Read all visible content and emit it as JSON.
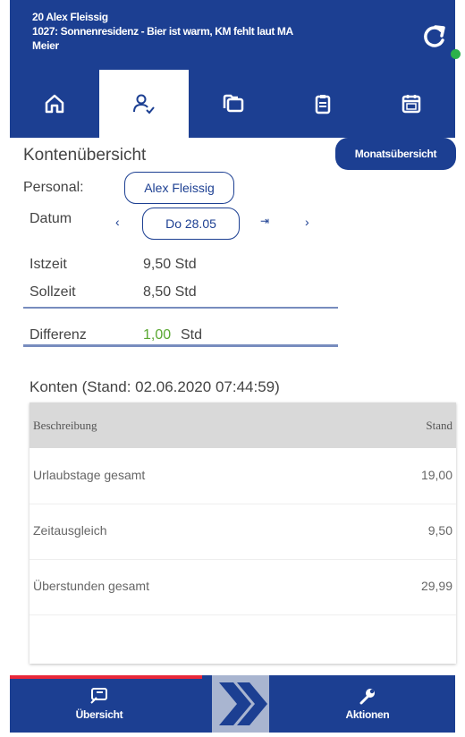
{
  "header": {
    "line1": "20 Alex Fleissig",
    "line2": "1027: Sonnenresidenz - Bier ist warm, KM fehlt laut MA",
    "line3": "Meier",
    "sync_icon": "refresh-icon",
    "status_color": "#2db24a"
  },
  "tabs": [
    {
      "icon": "home-icon",
      "active": false
    },
    {
      "icon": "user-check-icon",
      "active": true
    },
    {
      "icon": "folders-icon",
      "active": false
    },
    {
      "icon": "clipboard-icon",
      "active": false
    },
    {
      "icon": "calendar-icon",
      "active": false
    }
  ],
  "main": {
    "title": "Kontenübersicht",
    "month_button": "Monatsübersicht",
    "personal_label": "Personal:",
    "personal_value": "Alex Fleissig",
    "date_label": "Datum",
    "date_prev": "‹",
    "date_value": "Do 28.05",
    "date_today": "⇥",
    "date_next": "›",
    "istzeit_label": "Istzeit",
    "istzeit_value": "9,50 Std",
    "sollzeit_label": "Sollzeit",
    "sollzeit_value": "8,50 Std",
    "differenz_label": "Differenz",
    "differenz_num": "1,00",
    "differenz_unit": "Std"
  },
  "konten": {
    "title": "Konten (Stand: 02.06.2020 07:44:59)",
    "columns": [
      "Beschreibung",
      "Stand"
    ],
    "rows": [
      {
        "label": "Urlaubstage gesamt",
        "value": "19,00"
      },
      {
        "label": "Zeitausgleich",
        "value": "9,50"
      },
      {
        "label": "Überstunden gesamt",
        "value": "29,99"
      }
    ]
  },
  "bottom": {
    "left_label": "Übersicht",
    "right_label": "Aktionen",
    "accent": "#e8283a",
    "brand": "#1c3f92"
  }
}
